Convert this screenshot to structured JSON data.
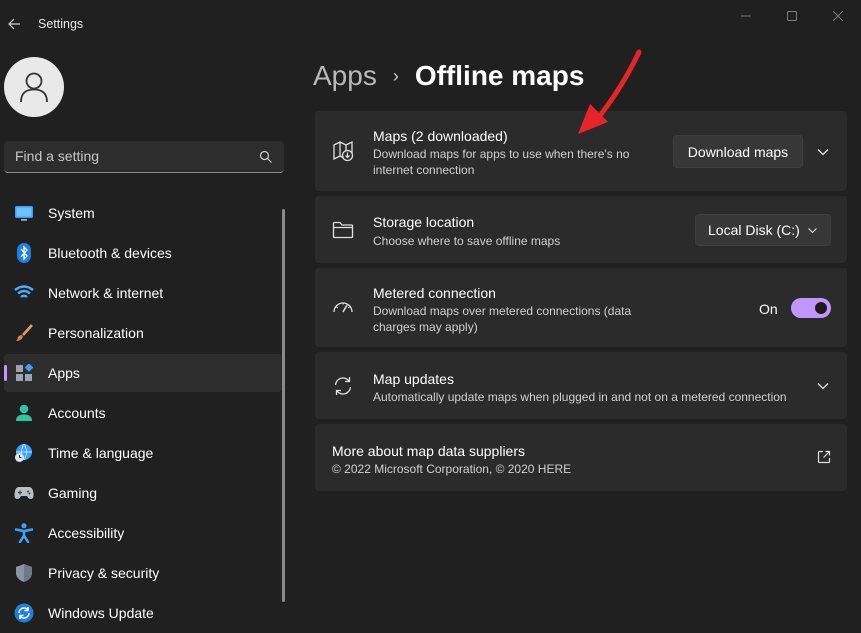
{
  "window": {
    "title": "Settings"
  },
  "search": {
    "placeholder": "Find a setting"
  },
  "sidebar": {
    "items": [
      {
        "label": "System",
        "icon": "monitor-icon"
      },
      {
        "label": "Bluetooth & devices",
        "icon": "bluetooth-icon"
      },
      {
        "label": "Network & internet",
        "icon": "wifi-icon"
      },
      {
        "label": "Personalization",
        "icon": "brush-icon"
      },
      {
        "label": "Apps",
        "icon": "apps-icon",
        "active": true
      },
      {
        "label": "Accounts",
        "icon": "person-icon"
      },
      {
        "label": "Time & language",
        "icon": "clock-globe-icon"
      },
      {
        "label": "Gaming",
        "icon": "gamepad-icon"
      },
      {
        "label": "Accessibility",
        "icon": "accessibility-icon"
      },
      {
        "label": "Privacy & security",
        "icon": "shield-icon"
      },
      {
        "label": "Windows Update",
        "icon": "update-icon"
      }
    ]
  },
  "breadcrumb": {
    "parent": "Apps",
    "separator": "›",
    "current": "Offline maps"
  },
  "cards": {
    "maps": {
      "title": "Maps (2 downloaded)",
      "desc_line1": "Download maps for apps to use when there's no",
      "desc_line2": "internet connection",
      "button": "Download maps"
    },
    "storage": {
      "title": "Storage location",
      "desc": "Choose where to save offline maps",
      "selected": "Local Disk (C:)"
    },
    "metered": {
      "title": "Metered connection",
      "desc_line1": "Download maps over metered connections (data",
      "desc_line2": "charges may apply)",
      "toggle_label": "On",
      "toggle_on": true
    },
    "updates": {
      "title": "Map updates",
      "desc": "Automatically update maps when plugged in and not on a metered connection"
    },
    "about": {
      "title": "More about map data suppliers",
      "desc": "© 2022 Microsoft Corporation, © 2020 HERE"
    }
  },
  "colors": {
    "accent": "#c296ff",
    "background": "#202020",
    "card": "#2b2b2b",
    "annotation_arrow": "#e8242b"
  }
}
